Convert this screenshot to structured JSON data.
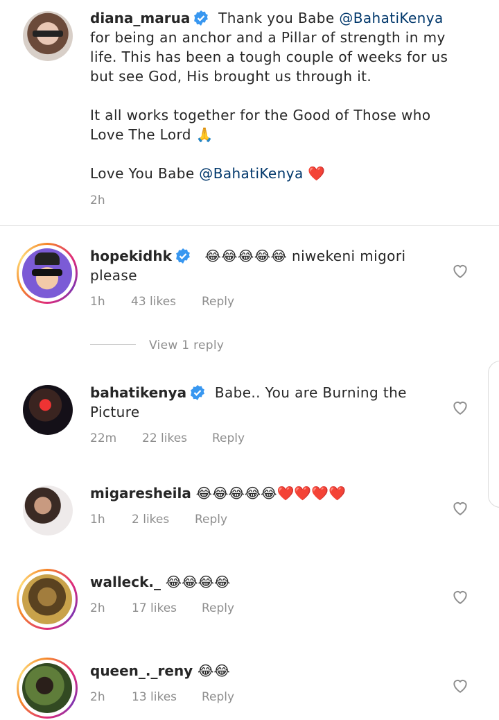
{
  "post": {
    "username": "diana_marua",
    "parts": [
      "Thank you Babe ",
      "@BahatiKenya",
      "\nfor being an anchor and a Pillar of strength in my\nlife. This has been a tough couple of weeks for us\nbut see God, His brought us through it.\n\nIt all works together for the Good of Those who\nLove The Lord 🙏\n\nLove You Babe ",
      "@BahatiKenya",
      " ❤️"
    ],
    "time": "2h"
  },
  "comments": [
    {
      "username": "hopekidhk",
      "verified": true,
      "text": "😂😂😂😂😂 niwekeni migori\nplease",
      "time": "1h",
      "likes": "43 likes",
      "reply": "Reply"
    },
    {
      "username": "bahatikenya",
      "verified": true,
      "text": "Babe.. You are Burning the\nPicture",
      "time": "22m",
      "likes": "22 likes",
      "reply": "Reply"
    },
    {
      "username": "migaresheila",
      "verified": false,
      "text": "😂😂😂😂😂❤️❤️❤️❤️",
      "time": "1h",
      "likes": "2 likes",
      "reply": "Reply"
    },
    {
      "username": "walleck._",
      "verified": false,
      "text": "😂😂😂😂",
      "time": "2h",
      "likes": "17 likes",
      "reply": "Reply"
    },
    {
      "username": "queen_._reny",
      "verified": false,
      "text": "😂😂",
      "time": "2h",
      "likes": "13 likes",
      "reply": "Reply"
    }
  ],
  "view_replies": "View 1 reply",
  "colors": {
    "verified": "#3897f0",
    "mention": "#00376b",
    "muted": "#8e8e8e"
  },
  "icons": [
    "verified-badge-icon",
    "heart-outline-icon"
  ]
}
